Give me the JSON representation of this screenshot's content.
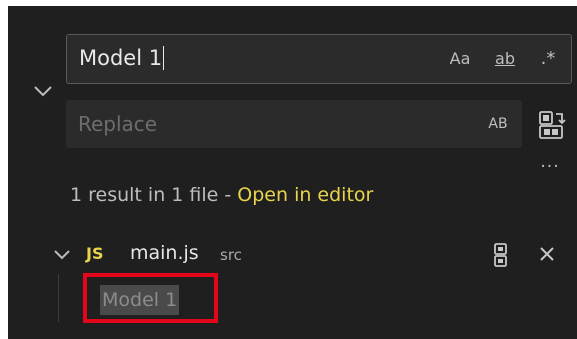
{
  "search": {
    "value": "Model 1",
    "match_case_label": "Aa",
    "whole_word_label": "ab",
    "regex_label": ".*"
  },
  "replace": {
    "placeholder": "Replace",
    "preserve_case_label": "AB"
  },
  "results": {
    "summary_text": "1 result in 1 file - ",
    "open_in_editor_label": "Open in editor"
  },
  "file": {
    "lang_badge": "JS",
    "name": "main.js",
    "directory": "src"
  },
  "match": {
    "text": "Model 1"
  },
  "colors": {
    "panel_background": "#1f1f1f",
    "input_background": "#2b2b2b",
    "link": "#e8d44d",
    "js_badge": "#e8d44d",
    "annotation_box": "#e3061a"
  },
  "icons": {
    "collapse_toggle": "chevron-down-icon",
    "replace_all": "replace-all-icon",
    "more": "ellipsis-icon",
    "file_toggle": "chevron-down-icon",
    "file_replace": "replace-icon",
    "dismiss": "close-icon"
  }
}
